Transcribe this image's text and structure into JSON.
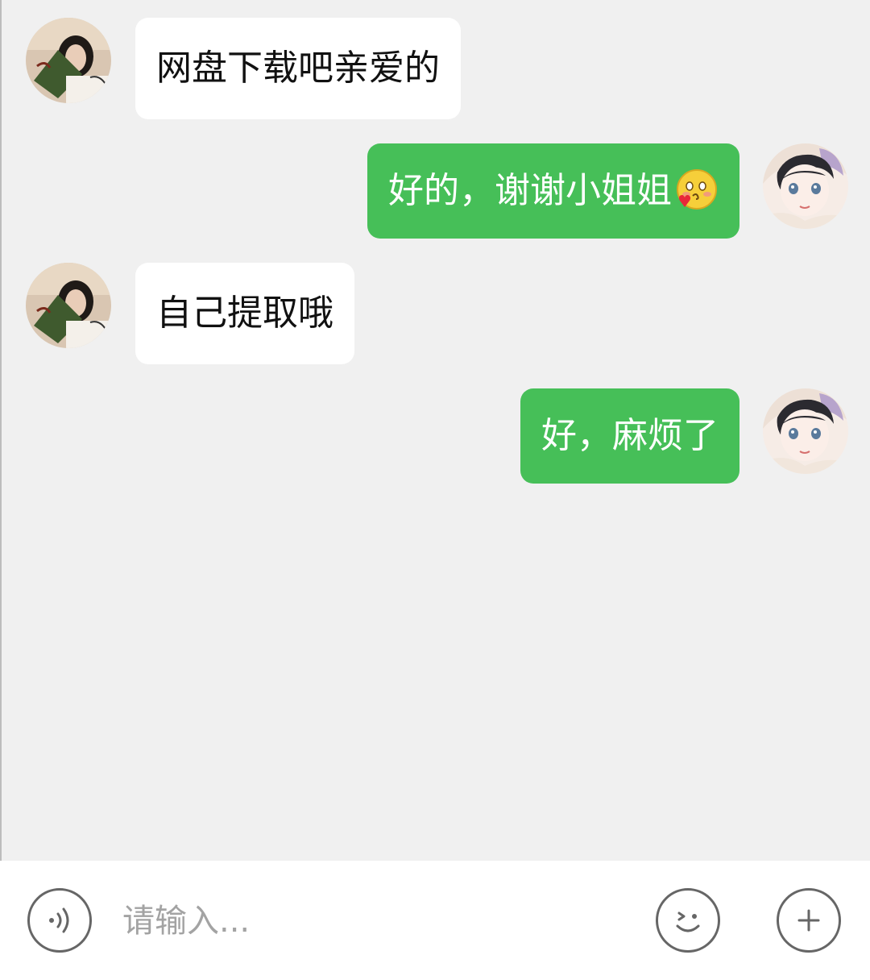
{
  "messages": [
    {
      "direction": "in",
      "text": "网盘下载吧亲爱的",
      "avatar": "female-photo-avatar"
    },
    {
      "direction": "out",
      "text": "好的，谢谢小姐姐",
      "emoji": "blush-heart-emoji",
      "avatar": "anime-girl-avatar"
    },
    {
      "direction": "in",
      "text": "自己提取哦",
      "avatar": "female-photo-avatar"
    },
    {
      "direction": "out",
      "text": "好，麻烦了",
      "avatar": "anime-girl-avatar"
    }
  ],
  "input_bar": {
    "placeholder": "请输入...",
    "value": "",
    "voice_icon": "voice-icon",
    "emoji_icon": "smiley-icon",
    "more_icon": "plus-icon"
  },
  "colors": {
    "background": "#f0f0f0",
    "incoming_bubble": "#ffffff",
    "outgoing_bubble": "#46bf58",
    "outgoing_text": "#ffffff",
    "incoming_text": "#111111"
  }
}
